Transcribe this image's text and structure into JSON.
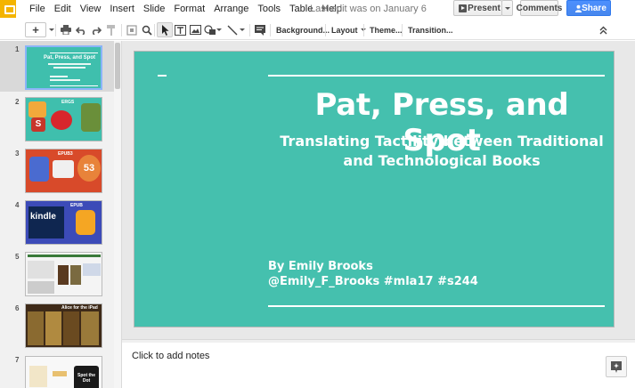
{
  "menu": {
    "items": [
      "File",
      "Edit",
      "View",
      "Insert",
      "Slide",
      "Format",
      "Arrange",
      "Tools",
      "Table",
      "Help"
    ],
    "last_edit": "Last edit was on January 6"
  },
  "header_buttons": {
    "present": "Present",
    "comments": "Comments",
    "share": "Share"
  },
  "toolbar": {
    "background": "Background...",
    "layout": "Layout",
    "theme": "Theme...",
    "transition": "Transition..."
  },
  "filmstrip": {
    "slides": [
      {
        "number": "1",
        "selected": true
      },
      {
        "number": "2"
      },
      {
        "number": "3"
      },
      {
        "number": "4"
      },
      {
        "number": "5"
      },
      {
        "number": "6"
      },
      {
        "number": "7"
      }
    ],
    "thumb_texts": {
      "t1_title": "Pat, Press, and Spot",
      "t2_label": "ERGS",
      "t3_label": "EPUB3",
      "t3_number": "53",
      "t4_kindle": "kindle",
      "t4_label": "EPUB",
      "t6_title": "Alice for the iPad",
      "t7_spot": "Spot the Dot"
    }
  },
  "slide": {
    "title": "Pat, Press, and Spot",
    "subtitle": "Translating Tactility between Traditional and Technological Books",
    "author_line1": "By Emily Brooks",
    "author_line2": "@Emily_F_Brooks #mla17 #s244",
    "background_color": "#45c0ae"
  },
  "notes": {
    "placeholder": "Click to add notes"
  },
  "colors": {
    "accent": "#f4b400",
    "share_blue": "#4787ed",
    "slide_teal": "#45c0ae"
  }
}
